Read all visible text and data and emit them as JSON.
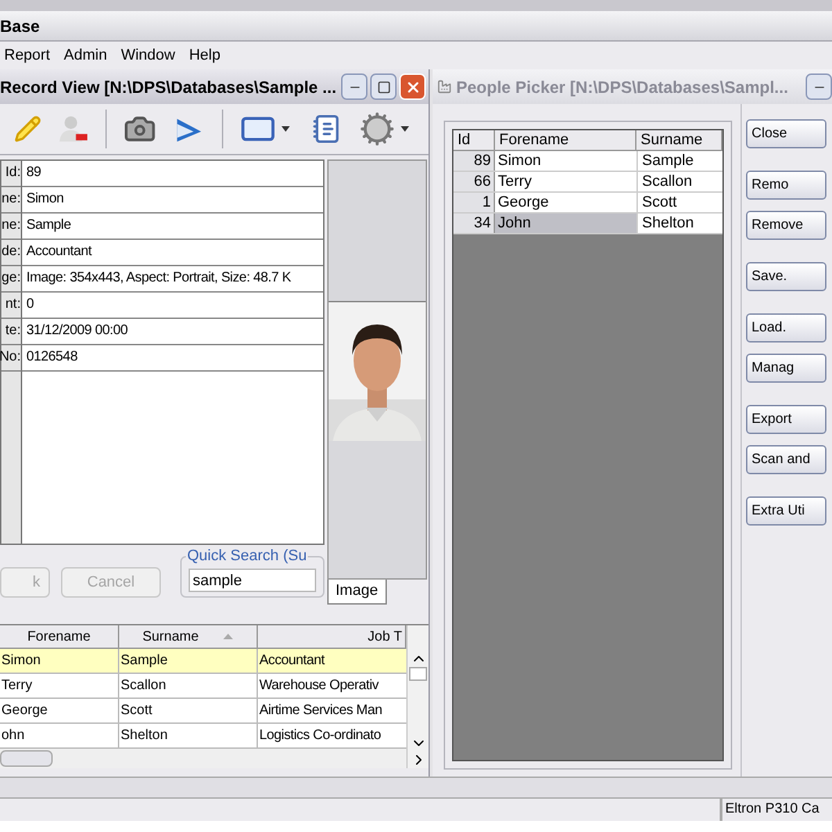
{
  "app": {
    "title": "Base"
  },
  "menu": [
    "Report",
    "Admin",
    "Window",
    "Help"
  ],
  "record_view": {
    "title": "Record View [N:\\DPS\\Databases\\Sample ...",
    "fields": [
      {
        "label": "Id:",
        "value": "89"
      },
      {
        "label": "ne:",
        "value": "Simon"
      },
      {
        "label": "ne:",
        "value": "Sample"
      },
      {
        "label": "de:",
        "value": "Accountant"
      },
      {
        "label": "ge:",
        "value": "Image: 354x443, Aspect: Portrait, Size: 48.7 K"
      },
      {
        "label": "nt:",
        "value": "0"
      },
      {
        "label": "te:",
        "value": "31/12/2009 00:00"
      },
      {
        "label": "No:",
        "value": "0126548"
      }
    ],
    "buttons": [
      {
        "label": "k",
        "disabled": true
      },
      {
        "label": "Cancel",
        "disabled": true
      }
    ],
    "quick_search": {
      "legend": "Quick Search (Su",
      "value": "sample"
    },
    "image_tab": "Image",
    "grid": {
      "columns": [
        "Forename",
        "Surname",
        "Job T"
      ],
      "rows": [
        {
          "cells": [
            "Simon",
            "Sample",
            "Accountant"
          ],
          "selected": true
        },
        {
          "cells": [
            "Terry",
            "Scallon",
            "Warehouse Operativ"
          ],
          "selected": false
        },
        {
          "cells": [
            "George",
            "Scott",
            "Airtime Services Man"
          ],
          "selected": false
        },
        {
          "cells": [
            "ohn",
            "Shelton",
            "Logistics Co-ordinato"
          ],
          "selected": false
        }
      ]
    }
  },
  "people_picker": {
    "title": "People Picker [N:\\DPS\\Databases\\Sampl...",
    "columns": [
      "Id",
      "Forename",
      "Surname"
    ],
    "rows": [
      {
        "id": "89",
        "forename": "Simon",
        "surname": "Sample",
        "selected": false
      },
      {
        "id": "66",
        "forename": "Terry",
        "surname": "Scallon",
        "selected": false
      },
      {
        "id": "1",
        "forename": "George",
        "surname": "Scott",
        "selected": false
      },
      {
        "id": "34",
        "forename": "John",
        "surname": "Shelton",
        "selected": true
      }
    ],
    "buttons": [
      "Close",
      "Remo",
      "Remove",
      "Save.",
      "Load.",
      "Manag",
      "Export",
      "Scan and",
      "Extra Uti"
    ]
  },
  "status_bar": {
    "printer": "Eltron P310 Ca"
  }
}
